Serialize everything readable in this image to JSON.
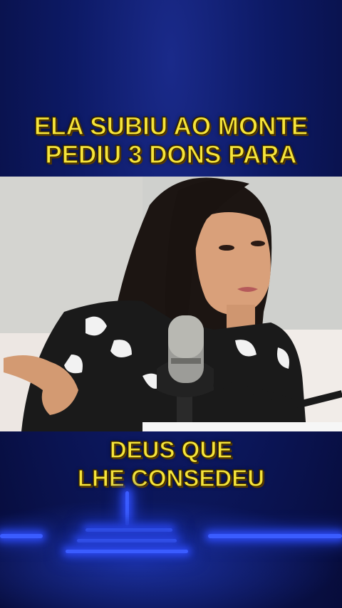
{
  "captions": {
    "top_line1": "ELA SUBIU AO MONTE",
    "top_line2": "PEDIU 3 DONS PARA",
    "bottom_line1": "DEUS QUE",
    "bottom_line2": "LHE CONSEDEU"
  },
  "colors": {
    "caption": "#f6e43a",
    "background": "#0b1450",
    "neon": "#3a5cff"
  }
}
